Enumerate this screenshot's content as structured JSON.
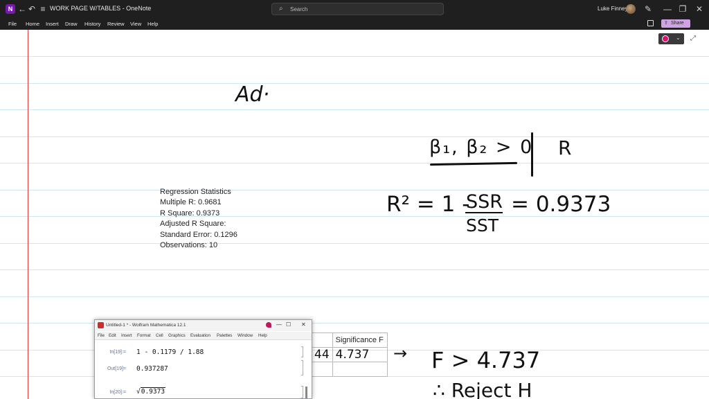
{
  "titlebar": {
    "logo_letter": "N",
    "title": "WORK PAGE W/TABLES - OneNote",
    "search_placeholder": "Search",
    "user_name": "Luke Finney",
    "icons": [
      "onenote-logo",
      "back-arrow-icon",
      "forward-arrow-icon",
      "undo-icon",
      "customize-icon",
      "search-icon",
      "avatar",
      "pen-icon",
      "minimize-icon",
      "maximize-icon",
      "close-icon"
    ]
  },
  "menubar": {
    "items": [
      "File",
      "Home",
      "Insert",
      "Draw",
      "History",
      "Review",
      "View",
      "Help"
    ],
    "share_label": "Share"
  },
  "page": {
    "regression_stats": [
      "Regression Statistics",
      "Multiple R: 0.9681",
      "R Square: 0.9373",
      "Adjusted R Square:",
      "Standard Error: 0.1296",
      "Observations: 10"
    ],
    "ink": {
      "ad": "Ad·",
      "beta": "β₁, β₂ > 0",
      "r": "R",
      "rsq": "R² = 1 -",
      "ssr": "SSR",
      "sst": "SST",
      "value": "= 0.9373",
      "arrow": "→",
      "fcrit": "F > 4.737",
      "reject": "∴ Reject H"
    },
    "table": {
      "header": "Significance F",
      "left_fragment": "44",
      "value": "4.737"
    }
  },
  "mathematica": {
    "title": "Untitled-1 * - Wolfram Mathematica 12.1",
    "menu": [
      "File",
      "Edit",
      "Insert",
      "Format",
      "Cell",
      "Graphics",
      "Evaluation",
      "Palettes",
      "Window",
      "Help"
    ],
    "cells": [
      {
        "label": "In[19]:=",
        "body": "1 - 0.1179 / 1.88"
      },
      {
        "label": "Out[19]=",
        "body": "0.937287"
      },
      {
        "label": "In[20]:=",
        "body": "√",
        "radicand": "0.9373"
      }
    ]
  }
}
